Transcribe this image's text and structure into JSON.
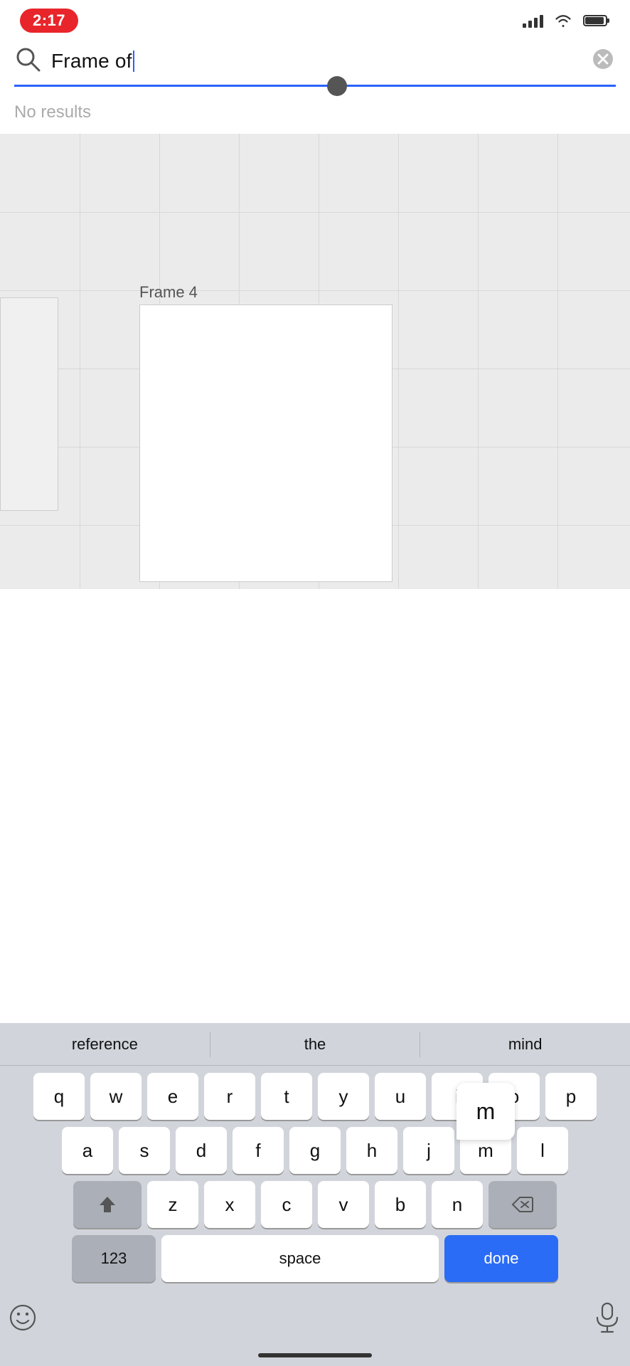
{
  "statusBar": {
    "time": "2:17",
    "signalLabel": "signal",
    "wifiLabel": "wifi",
    "batteryLabel": "battery"
  },
  "search": {
    "query": "Frame of",
    "placeholder": "Search",
    "clearLabel": "clear search",
    "underlineColor": "#2962ff"
  },
  "results": {
    "noResultsText": "No results"
  },
  "canvas": {
    "frameLabel": "Frame 4"
  },
  "autocomplete": {
    "items": [
      "reference",
      "the",
      "mind"
    ]
  },
  "keyboard": {
    "rows": [
      [
        "q",
        "w",
        "e",
        "r",
        "t",
        "y",
        "u",
        "i",
        "o",
        "p"
      ],
      [
        "a",
        "s",
        "d",
        "f",
        "g",
        "h",
        "j",
        "m",
        "l"
      ],
      [
        "z",
        "x",
        "c",
        "v",
        "b",
        "n"
      ]
    ],
    "shiftLabel": "⇧",
    "backspaceLabel": "⌫",
    "numbersLabel": "123",
    "spaceLabel": "space",
    "doneLabel": "done",
    "activeKey": "m"
  },
  "bottomBar": {
    "emojiLabel": "emoji",
    "micLabel": "microphone"
  }
}
